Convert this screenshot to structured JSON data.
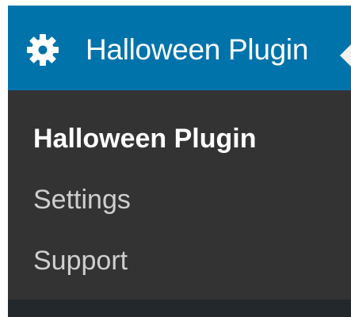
{
  "menu": {
    "title": "Halloween Plugin",
    "icon": "gear-icon",
    "colors": {
      "header_bg": "#0073aa",
      "submenu_bg": "#333333",
      "active_text": "#ffffff",
      "inactive_text": "#cfcfcf"
    },
    "submenu": [
      {
        "label": "Halloween Plugin",
        "active": true
      },
      {
        "label": "Settings",
        "active": false
      },
      {
        "label": "Support",
        "active": false
      }
    ]
  }
}
